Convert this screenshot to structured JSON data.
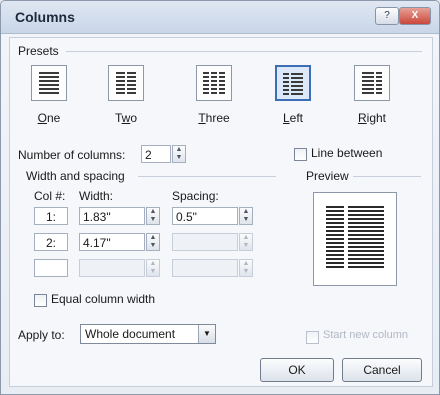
{
  "window": {
    "title": "Columns",
    "help_label": "?",
    "close_label": "X"
  },
  "presets": {
    "group_label": "Presets",
    "items": [
      {
        "label": "One",
        "mnemonic": "O",
        "rest": "ne"
      },
      {
        "label": "Two",
        "mnemonic": "w",
        "prefix": "T",
        "rest": "o"
      },
      {
        "label": "Three",
        "mnemonic": "T",
        "rest": "hree"
      },
      {
        "label": "Left",
        "mnemonic": "L",
        "rest": "eft"
      },
      {
        "label": "Right",
        "mnemonic": "R",
        "rest": "ight"
      }
    ],
    "selected": "Left"
  },
  "number_of_columns": {
    "label": "Number of columns:",
    "value": "2"
  },
  "line_between": {
    "label": "Line between",
    "checked": false
  },
  "width_spacing": {
    "group_label": "Width and spacing",
    "col_header": "Col #:",
    "width_header": "Width:",
    "spacing_header": "Spacing:",
    "rows": [
      {
        "col": "1:",
        "width": "1.83\"",
        "spacing": "0.5\""
      },
      {
        "col": "2:",
        "width": "4.17\"",
        "spacing": ""
      },
      {
        "col": "",
        "width": "",
        "spacing": ""
      }
    ]
  },
  "preview": {
    "group_label": "Preview"
  },
  "equal_column_width": {
    "label": "Equal column width",
    "checked": false
  },
  "apply_to": {
    "label": "Apply to:",
    "value": "Whole document"
  },
  "start_new_column": {
    "label": "Start new column",
    "checked": false
  },
  "buttons": {
    "ok": "OK",
    "cancel": "Cancel"
  }
}
